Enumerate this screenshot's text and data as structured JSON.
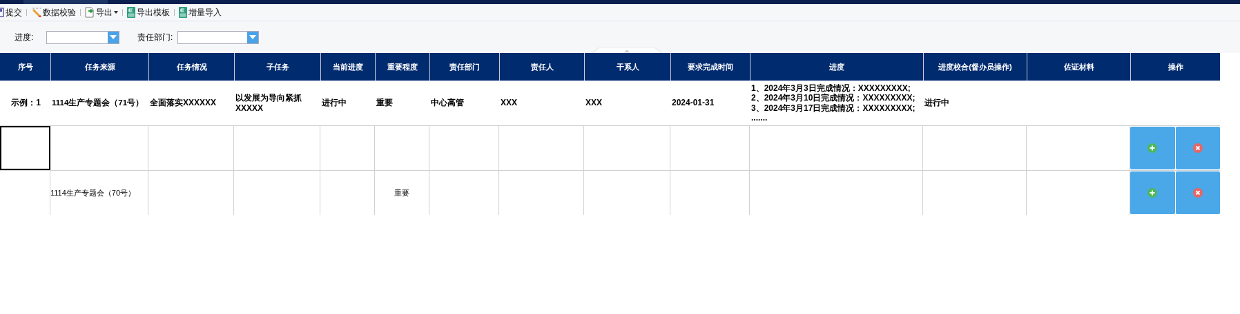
{
  "toolbar": [
    {
      "label": "提交",
      "kind": "disk",
      "caret": false
    },
    {
      "label": "数据校验",
      "kind": "pencil",
      "caret": false
    },
    {
      "label": "导出",
      "kind": "export",
      "caret": true
    },
    {
      "label": "导出模板",
      "kind": "sheet",
      "caret": false
    },
    {
      "label": "增量导入",
      "kind": "sheet",
      "caret": false
    }
  ],
  "filters": [
    {
      "label": "进度:"
    },
    {
      "label": "责任部门:"
    }
  ],
  "table": {
    "columns": [
      "序号",
      "任务来源",
      "任务情况",
      "子任务",
      "当前进度",
      "重要程度",
      "责任部门",
      "责任人",
      "干系人",
      "要求完成时间",
      "进度",
      "进度校合(督办员操作)",
      "佐证材料",
      "操作"
    ],
    "example_row": [
      "示例：1",
      "1114生产专题会（71号）",
      "全面落实XXXXXX",
      "以发展为导向紧抓XXXXX",
      "进行中",
      "重要",
      "中心高管",
      "XXX",
      "XXX",
      "2024-01-31",
      [
        "1、2024年3月3日完成情况：XXXXXXXXX;",
        "2、2024年3月10日完成情况：XXXXXXXXX;",
        "3、2024年3月17日完成情况：XXXXXXXXX;",
        "......."
      ],
      "进行中"
    ],
    "rows": [
      {
        "first_cell_focused": true,
        "cells": [
          "",
          "",
          "",
          "",
          "",
          "",
          "",
          "",
          "",
          "",
          "",
          "",
          ""
        ]
      },
      {
        "first_cell_focused": false,
        "cells": [
          "",
          "1114生产专题会（70号）",
          "",
          "",
          "",
          "重要",
          "",
          "",
          "",
          "",
          "",
          "",
          ""
        ]
      }
    ]
  }
}
